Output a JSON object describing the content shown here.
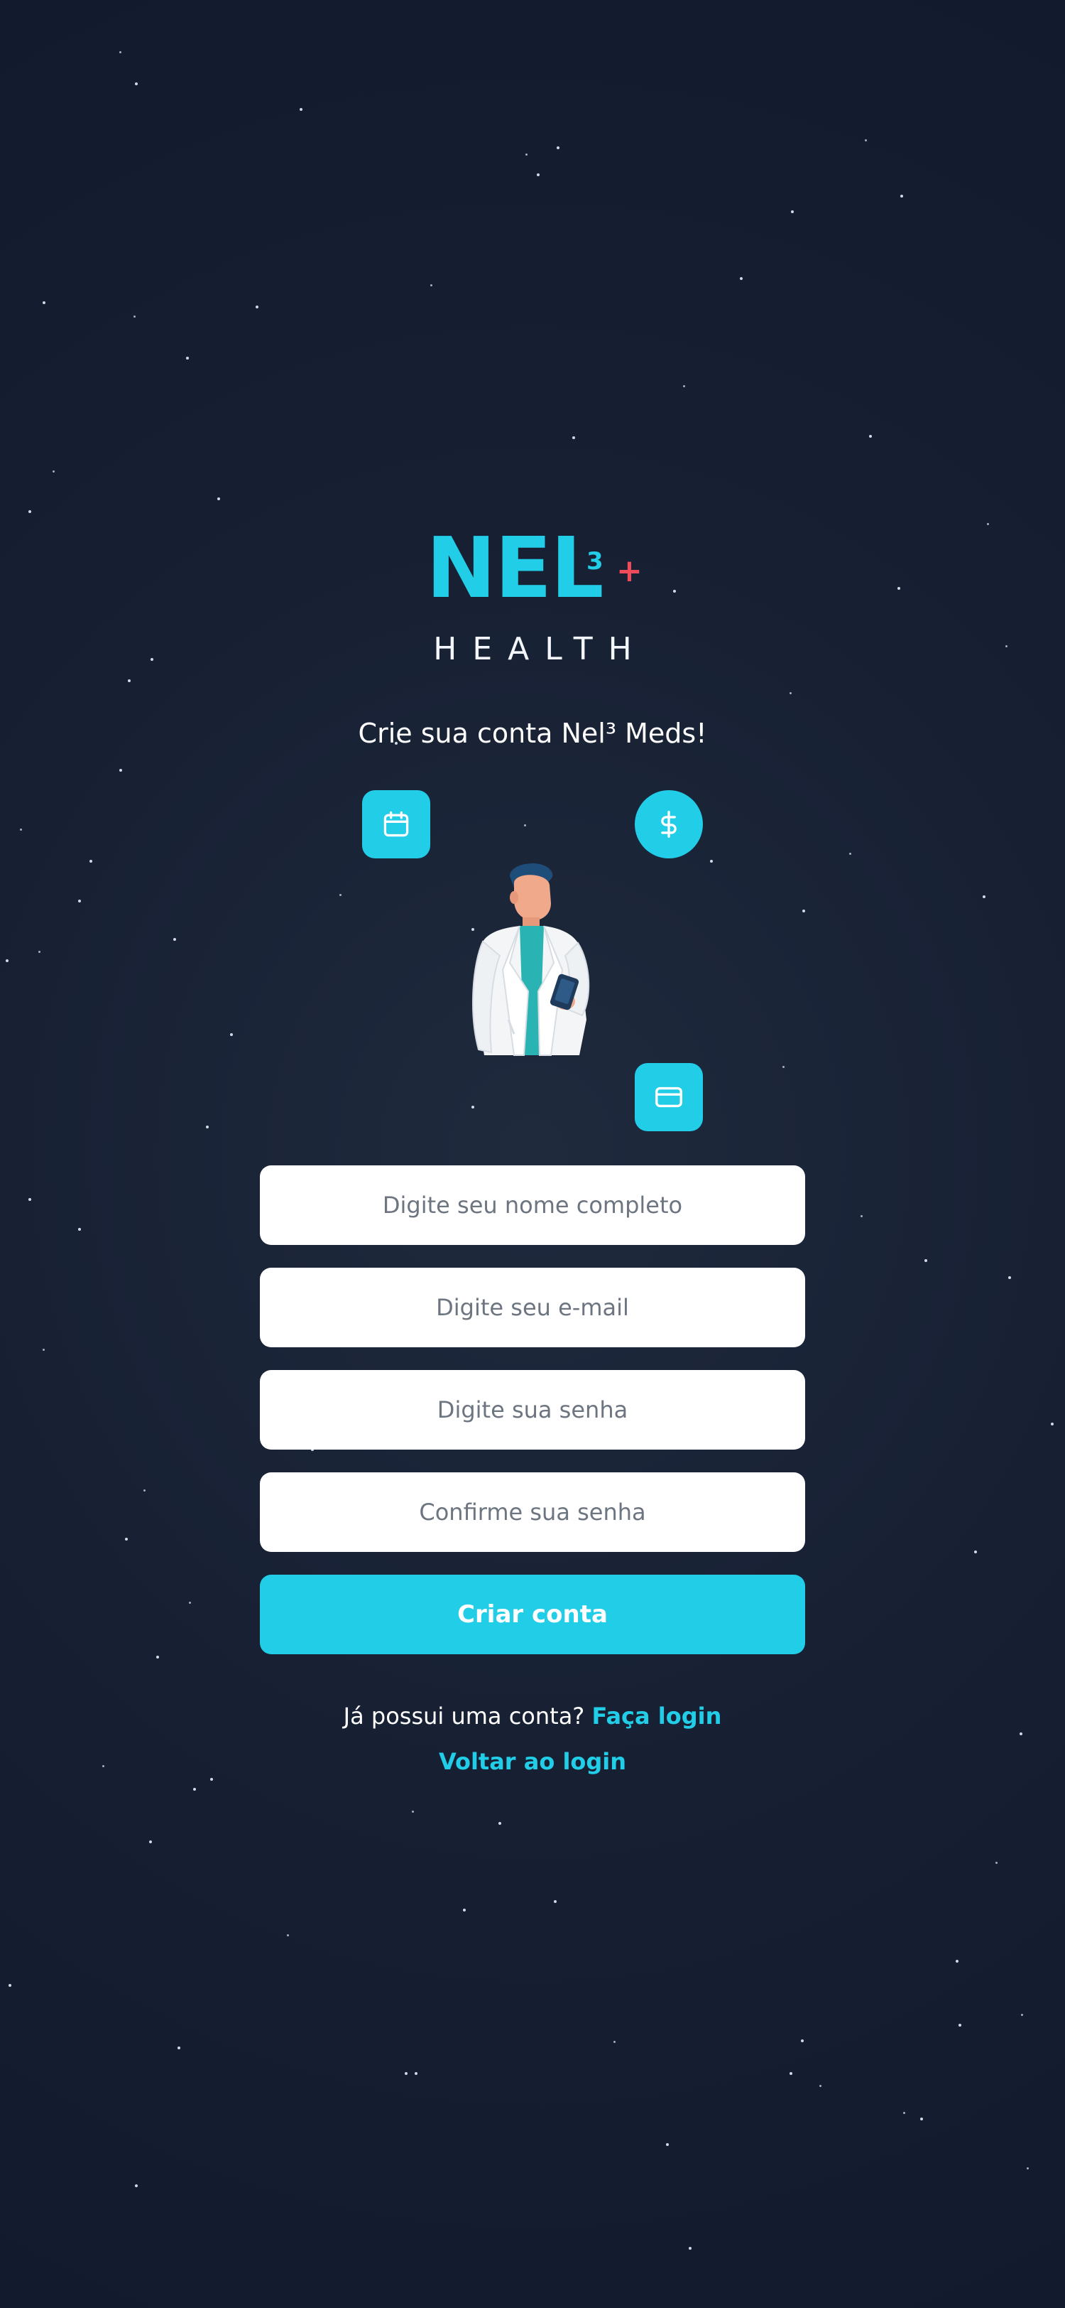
{
  "brand": {
    "logo_mark": "NEL",
    "logo_superscript": "3",
    "logo_plus": "+",
    "logo_subtitle": "HEALTH"
  },
  "headline": "Crie sua conta Nel³ Meds!",
  "feature_icons": [
    {
      "name": "calendar-icon",
      "shape": "rounded-square"
    },
    {
      "name": "dollar-icon",
      "shape": "circle"
    },
    {
      "name": "credit-card-icon",
      "shape": "rounded-square"
    }
  ],
  "illustration": "doctor-with-phone",
  "form": {
    "name_placeholder": "Digite seu nome completo",
    "email_placeholder": "Digite seu e-mail",
    "password_placeholder": "Digite sua senha",
    "confirm_placeholder": "Confirme sua senha",
    "submit_label": "Criar conta"
  },
  "footer": {
    "have_account_text": "Já possui uma conta?",
    "login_link": "Faça login",
    "back_link": "Voltar ao login"
  },
  "colors": {
    "background": "#172033",
    "accent": "#22cde8",
    "plus_red": "#ef4b5b",
    "field_background": "#ffffff"
  }
}
